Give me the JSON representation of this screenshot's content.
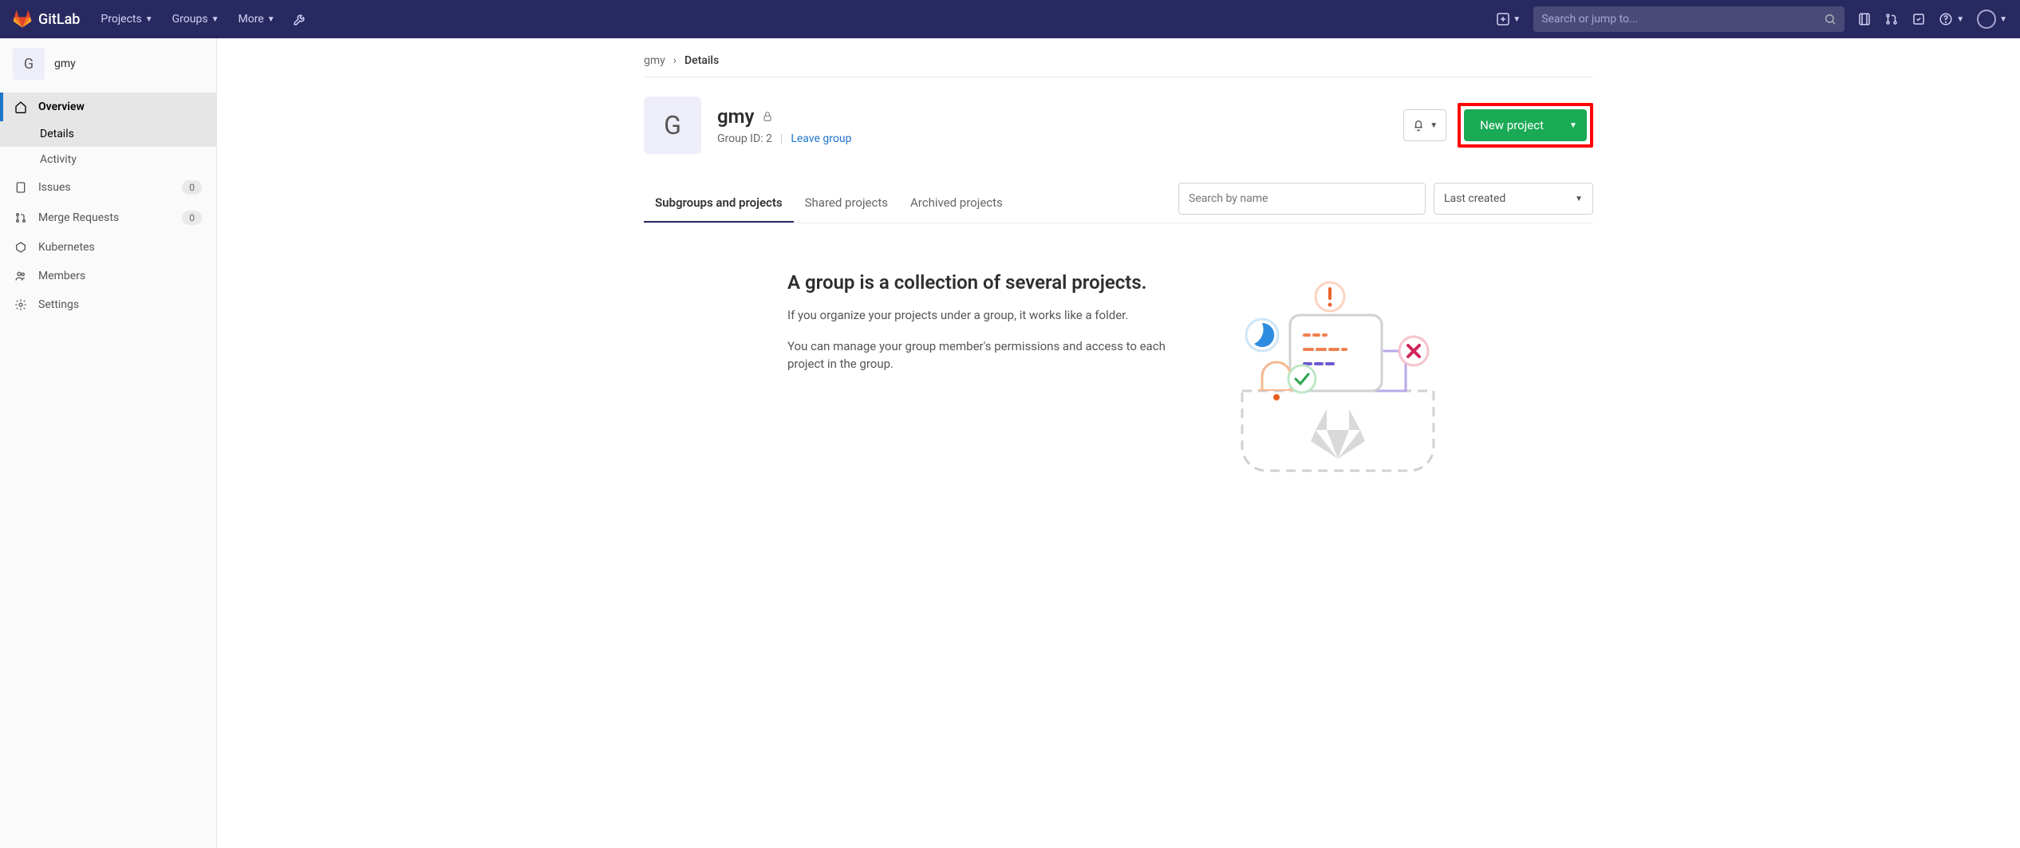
{
  "topnav": {
    "brand": "GitLab",
    "menu": [
      {
        "label": "Projects"
      },
      {
        "label": "Groups"
      },
      {
        "label": "More"
      }
    ],
    "search_placeholder": "Search or jump to..."
  },
  "sidebar": {
    "group_initial": "G",
    "group_name": "gmy",
    "items": [
      {
        "label": "Overview",
        "icon": "home",
        "active": true,
        "subs": [
          {
            "label": "Details",
            "active": true
          },
          {
            "label": "Activity",
            "active": false
          }
        ]
      },
      {
        "label": "Issues",
        "icon": "issues",
        "count": "0"
      },
      {
        "label": "Merge Requests",
        "icon": "merge",
        "count": "0"
      },
      {
        "label": "Kubernetes",
        "icon": "kube"
      },
      {
        "label": "Members",
        "icon": "members"
      },
      {
        "label": "Settings",
        "icon": "gear"
      }
    ]
  },
  "breadcrumb": {
    "root": "gmy",
    "current": "Details"
  },
  "group": {
    "initial": "G",
    "name": "gmy",
    "id_label": "Group ID: 2",
    "leave": "Leave group",
    "new_project": "New project"
  },
  "tabs": {
    "items": [
      {
        "label": "Subgroups and projects",
        "active": true
      },
      {
        "label": "Shared projects"
      },
      {
        "label": "Archived projects"
      }
    ],
    "search_placeholder": "Search by name",
    "sort": "Last created"
  },
  "empty": {
    "title": "A group is a collection of several projects.",
    "p1": "If you organize your projects under a group, it works like a folder.",
    "p2": "You can manage your group member's permissions and access to each project in the group."
  }
}
